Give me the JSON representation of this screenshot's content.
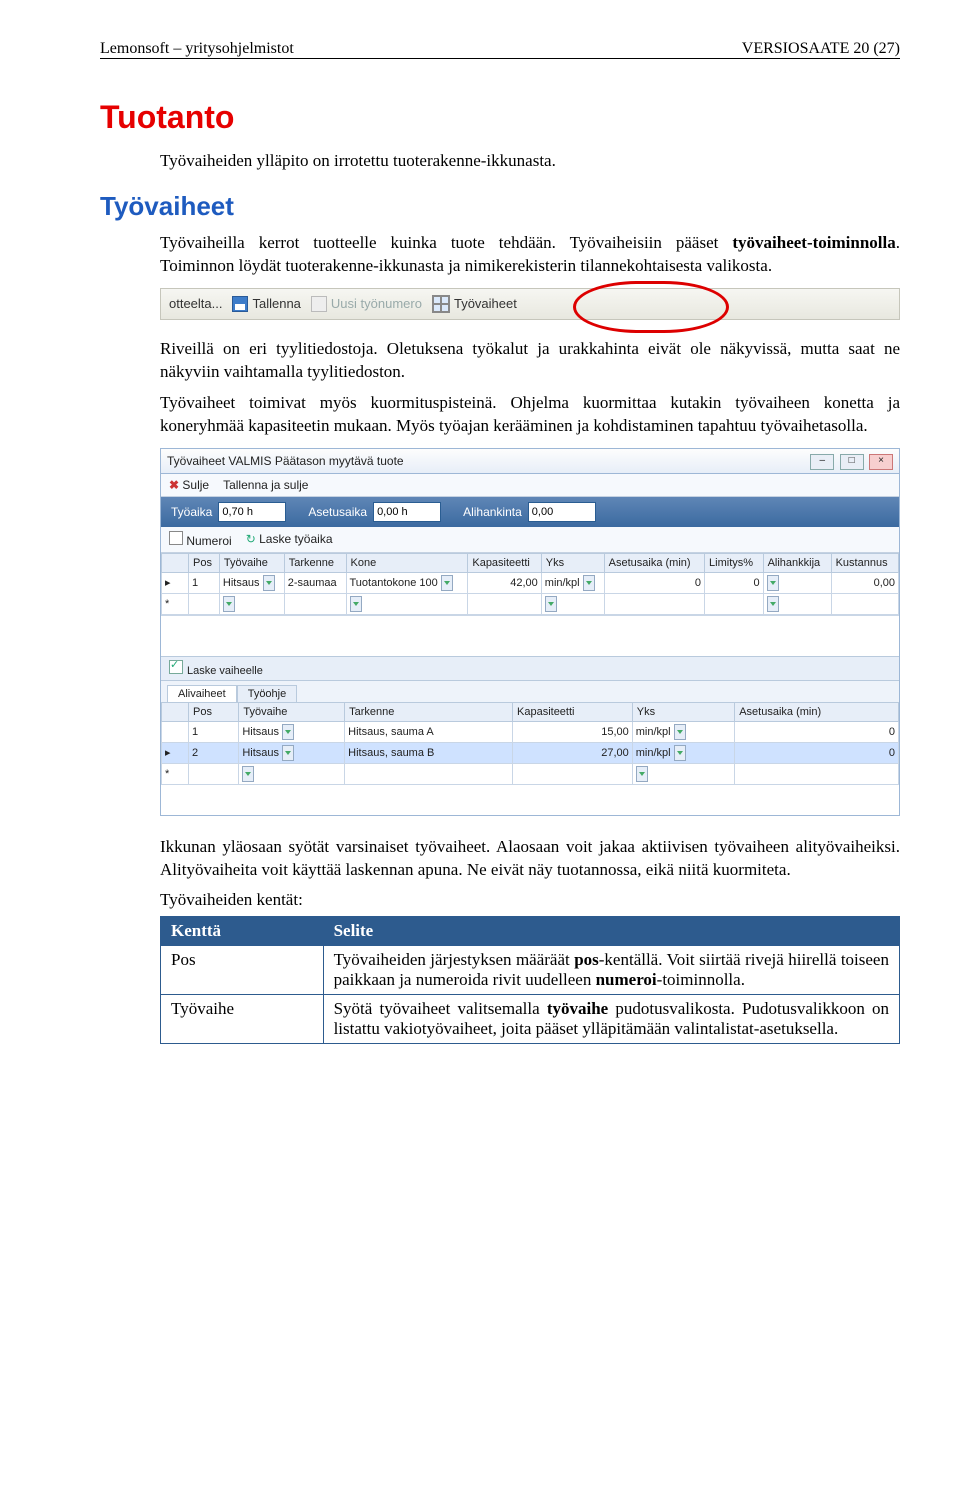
{
  "header": {
    "left": "Lemonsoft – yritysohjelmistot",
    "right": "VERSIOSAATE  20 (27)"
  },
  "h1": "Tuotanto",
  "intro1": "Työvaiheiden ylläpito on irrotettu tuoterakenne-ikkunasta.",
  "h2": "Työvaiheet",
  "p1a": "Työvaiheilla kerrot tuotteelle kuinka tuote tehdään. Työvaiheisiin pääset ",
  "p1b": "työvaiheet-toiminnolla",
  "p1c": ". Toiminnon löydät tuoterakenne-ikkunasta ja nimikerekisterin tilannekohtaisesta valikosta.",
  "tb1": {
    "otteelta": "otteelta...",
    "tallenna": "Tallenna",
    "uusi": "Uusi työnumero",
    "tyovaiheet": "Työvaiheet"
  },
  "p2": "Riveillä on eri tyylitiedostoja. Oletuksena työkalut ja urakkahinta eivät ole näkyvissä, mutta saat ne näkyviin vaihtamalla tyylitiedoston.",
  "p3": "Työvaiheet toimivat myös kuormituspisteinä. Ohjelma kuormittaa kutakin työvaiheen konetta ja koneryhmää kapasiteetin mukaan. Myös työajan kerääminen ja kohdistaminen tapahtuu työvaihetasolla.",
  "win": {
    "title": "Työvaiheet VALMIS Päätason myytävä tuote",
    "actions": {
      "sulje": "Sulje",
      "tallennaSulje": "Tallenna ja sulje"
    },
    "summary": {
      "tyoaika_lbl": "Työaika",
      "tyoaika_val": "0,70 h",
      "asetusaika_lbl": "Asetusaika",
      "asetusaika_val": "0,00 h",
      "alihankinta_lbl": "Alihankinta",
      "alihankinta_val": "0,00"
    },
    "toolbar2": {
      "numeroi": "Numeroi",
      "laske": "Laske työaika"
    },
    "cols": {
      "pos": "Pos",
      "tyovaihe": "Työvaihe",
      "tarkenne": "Tarkenne",
      "kone": "Kone",
      "kap": "Kapasiteetti",
      "yks": "Yks",
      "asetus": "Asetusaika (min)",
      "limitys": "Limitys%",
      "ali": "Alihankkija",
      "kust": "Kustannus"
    },
    "row1": {
      "pos": "1",
      "tyovaihe": "Hitsaus",
      "tarkenne": "2-saumaa",
      "kone": "Tuotantokone 100",
      "kap": "42,00",
      "yks": "min/kpl",
      "asetus": "0",
      "limitys": "0",
      "ali": "",
      "kust": "0,00"
    },
    "laskeVaiheelle": "Laske vaiheelle",
    "tabs": {
      "alivaiheet": "Alivaiheet",
      "tyoohje": "Työohje"
    },
    "subcols": {
      "pos": "Pos",
      "tyovaihe": "Työvaihe",
      "tarkenne": "Tarkenne",
      "kap": "Kapasiteetti",
      "yks": "Yks",
      "asetus": "Asetusaika (min)"
    },
    "sub1": {
      "pos": "1",
      "tyovaihe": "Hitsaus",
      "tarkenne": "Hitsaus, sauma A",
      "kap": "15,00",
      "yks": "min/kpl",
      "asetus": "0"
    },
    "sub2": {
      "pos": "2",
      "tyovaihe": "Hitsaus",
      "tarkenne": "Hitsaus, sauma B",
      "kap": "27,00",
      "yks": "min/kpl",
      "asetus": "0"
    }
  },
  "p4": "Ikkunan yläosaan syötät varsinaiset työvaiheet. Alaosaan voit jakaa aktiivisen työvaiheen alityövaiheiksi. Alityövaiheita voit käyttää laskennan apuna. Ne eivät näy tuotannossa, eikä niitä kuormiteta.",
  "p5": "Työvaiheiden kentät:",
  "tbl": {
    "h1": "Kenttä",
    "h2": "Selite",
    "r1c1": "Pos",
    "r1a": "Työvaiheiden järjestyksen määräät ",
    "r1b": "pos",
    "r1c": "-kentällä. Voit siirtää rivejä hiirellä toiseen paikkaan ja numeroida rivit uudelleen ",
    "r1d": "numeroi",
    "r1e": "-toiminnolla.",
    "r2c1": "Työvaihe",
    "r2a": "Syötä työvaiheet valitsemalla ",
    "r2b": "työvaihe",
    "r2c": " pudotusvalikosta. Pudotusvalikkoon on listattu vakiotyövaiheet, joita pääset ylläpitämään valintalistat-asetuksella."
  }
}
